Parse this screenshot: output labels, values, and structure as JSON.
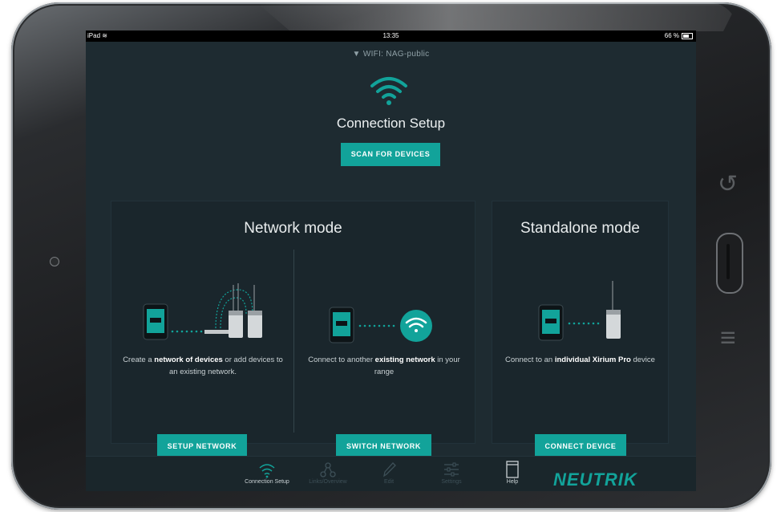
{
  "status_bar": {
    "device": "iPad",
    "time": "13:35",
    "battery": "66 %"
  },
  "header": {
    "wifi_label": "WIFI: NAG-public",
    "title": "Connection Setup",
    "scan_button": "SCAN FOR DEVICES"
  },
  "network_mode": {
    "title": "Network mode",
    "setup": {
      "desc_pre": "Create a ",
      "desc_bold": "network of devices",
      "desc_post": " or add devices to an existing network.",
      "button": "SETUP NETWORK"
    },
    "switch": {
      "desc_pre": "Connect to another ",
      "desc_bold": "existing network",
      "desc_post": " in your range",
      "button": "SWITCH NETWORK"
    }
  },
  "standalone_mode": {
    "title": "Standalone mode",
    "desc_pre": "Connect to an ",
    "desc_bold": "individual Xirium Pro",
    "desc_post": " device",
    "button": "CONNECT DEVICE"
  },
  "tabbar": {
    "tabs": [
      {
        "label": "Connection Setup",
        "icon": "wifi-icon",
        "active": true
      },
      {
        "label": "Links/Overview",
        "icon": "links-icon",
        "active": false
      },
      {
        "label": "Edit",
        "icon": "pencil-icon",
        "active": false
      },
      {
        "label": "Settings",
        "icon": "sliders-icon",
        "active": false
      },
      {
        "label": "Help",
        "icon": "book-icon",
        "active": true
      }
    ],
    "logo": "NEUTRIK"
  },
  "colors": {
    "accent": "#12a39a",
    "background": "#1e2b31",
    "panel": "#1a262c"
  }
}
